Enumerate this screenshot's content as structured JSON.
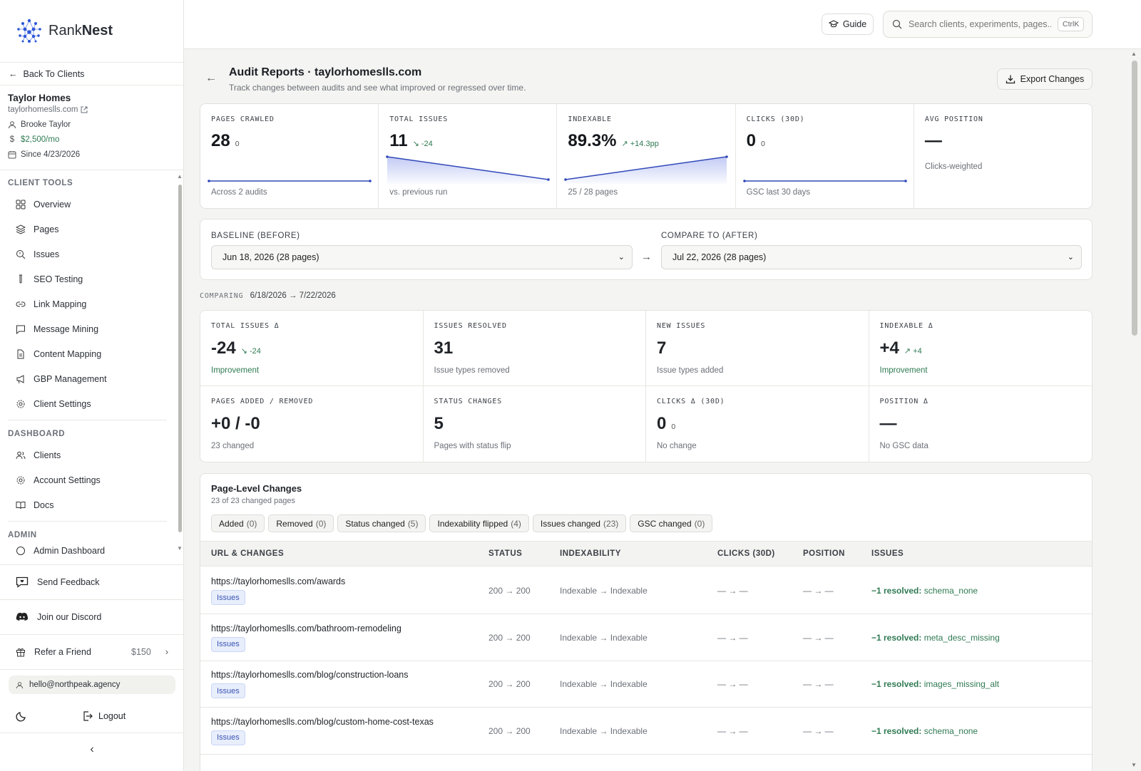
{
  "brand": {
    "name_light": "Rank",
    "name_bold": "Nest"
  },
  "sidebar": {
    "back_label": "Back To Clients",
    "client": {
      "name": "Taylor Homes",
      "url": "taylorhomeslls.com",
      "owner": "Brooke Taylor",
      "price": "$2,500/mo",
      "since": "Since 4/23/2026"
    },
    "sections": [
      {
        "title": "CLIENT TOOLS",
        "items": [
          "Overview",
          "Pages",
          "Issues",
          "SEO Testing",
          "Link Mapping",
          "Message Mining",
          "Content Mapping",
          "GBP Management",
          "Client Settings"
        ]
      },
      {
        "title": "DASHBOARD",
        "items": [
          "Clients",
          "Account Settings",
          "Docs"
        ]
      },
      {
        "title": "ADMIN",
        "items": [
          "Admin Dashboard"
        ]
      }
    ],
    "feedback": "Send Feedback",
    "discord": "Join our Discord",
    "refer": {
      "label": "Refer a Friend",
      "amount": "$150"
    },
    "email": "hello@northpeak.agency",
    "logout": "Logout"
  },
  "topbar": {
    "guide": "Guide",
    "search_placeholder": "Search clients, experiments, pages...",
    "shortcut": "CtrlK"
  },
  "header": {
    "title": "Audit Reports · taylorhomeslls.com",
    "subtitle": "Track changes between audits and see what improved or regressed over time.",
    "export": "Export Changes"
  },
  "kpis": [
    {
      "label": "PAGES CRAWLED",
      "value": "28",
      "small": "0",
      "delta": "",
      "foot": "Across 2 audits",
      "spark": [
        1,
        1
      ]
    },
    {
      "label": "TOTAL ISSUES",
      "value": "11",
      "small": "",
      "delta": "-24",
      "foot": "vs. previous run",
      "spark": [
        35,
        11
      ]
    },
    {
      "label": "INDEXABLE",
      "value": "89.3%",
      "small": "",
      "delta": "+14.3pp",
      "foot": "25 / 28 pages",
      "spark": [
        75,
        89.3
      ]
    },
    {
      "label": "CLICKS (30D)",
      "value": "0",
      "small": "0",
      "delta": "",
      "foot": "GSC last 30 days",
      "spark": [
        0,
        0
      ]
    },
    {
      "label": "AVG POSITION",
      "value": "—",
      "small": "",
      "delta": "",
      "sub": "Clicks-weighted"
    }
  ],
  "compare": {
    "baseline_label": "BASELINE (BEFORE)",
    "baseline_value": "Jun 18, 2026 (28 pages)",
    "after_label": "COMPARE TO (AFTER)",
    "after_value": "Jul 22, 2026 (28 pages)",
    "comparing_key": "COMPARING",
    "from": "6/18/2026",
    "to": "7/22/2026"
  },
  "deltas": [
    {
      "label": "TOTAL ISSUES Δ",
      "value": "-24",
      "delta": "-24",
      "small": "",
      "note": "Improvement",
      "good": true
    },
    {
      "label": "ISSUES RESOLVED",
      "value": "31",
      "delta": "",
      "small": "",
      "note": "Issue types removed",
      "good": false
    },
    {
      "label": "NEW ISSUES",
      "value": "7",
      "delta": "",
      "small": "",
      "note": "Issue types added",
      "good": false
    },
    {
      "label": "INDEXABLE Δ",
      "value": "+4",
      "delta": "+4",
      "small": "",
      "note": "Improvement",
      "good": true
    },
    {
      "label": "PAGES ADDED / REMOVED",
      "value": "+0 / -0",
      "delta": "",
      "small": "",
      "note": "23 changed",
      "good": false
    },
    {
      "label": "STATUS CHANGES",
      "value": "5",
      "delta": "",
      "small": "",
      "note": "Pages with status flip",
      "good": false
    },
    {
      "label": "CLICKS Δ (30D)",
      "value": "0",
      "delta": "",
      "small": "0",
      "note": "No change",
      "good": false
    },
    {
      "label": "POSITION Δ",
      "value": "—",
      "delta": "",
      "small": "",
      "note": "No GSC data",
      "good": false
    }
  ],
  "changes": {
    "title": "Page-Level Changes",
    "subtitle": "23 of 23 changed pages",
    "chips": [
      {
        "label": "Added",
        "count": "(0)"
      },
      {
        "label": "Removed",
        "count": "(0)"
      },
      {
        "label": "Status changed",
        "count": "(5)"
      },
      {
        "label": "Indexability flipped",
        "count": "(4)"
      },
      {
        "label": "Issues changed",
        "count": "(23)"
      },
      {
        "label": "GSC changed",
        "count": "(0)"
      }
    ],
    "columns": [
      "URL & CHANGES",
      "STATUS",
      "INDEXABILITY",
      "CLICKS (30D)",
      "POSITION",
      "ISSUES"
    ],
    "rows": [
      {
        "url": "https://taylorhomeslls.com/awards",
        "tag": "Issues",
        "status": "200 → 200",
        "index": "Indexable → Indexable",
        "clicks": "— → —",
        "position": "— → —",
        "res_count": "−1 resolved:",
        "res_item": "schema_none"
      },
      {
        "url": "https://taylorhomeslls.com/bathroom-remodeling",
        "tag": "Issues",
        "status": "200 → 200",
        "index": "Indexable → Indexable",
        "clicks": "— → —",
        "position": "— → —",
        "res_count": "−1 resolved:",
        "res_item": "meta_desc_missing"
      },
      {
        "url": "https://taylorhomeslls.com/blog/construction-loans",
        "tag": "Issues",
        "status": "200 → 200",
        "index": "Indexable → Indexable",
        "clicks": "— → —",
        "position": "— → —",
        "res_count": "−1 resolved:",
        "res_item": "images_missing_alt"
      },
      {
        "url": "https://taylorhomeslls.com/blog/custom-home-cost-texas",
        "tag": "Issues",
        "status": "200 → 200",
        "index": "Indexable → Indexable",
        "clicks": "— → —",
        "position": "— → —",
        "res_count": "−1 resolved:",
        "res_item": "schema_none"
      }
    ]
  }
}
